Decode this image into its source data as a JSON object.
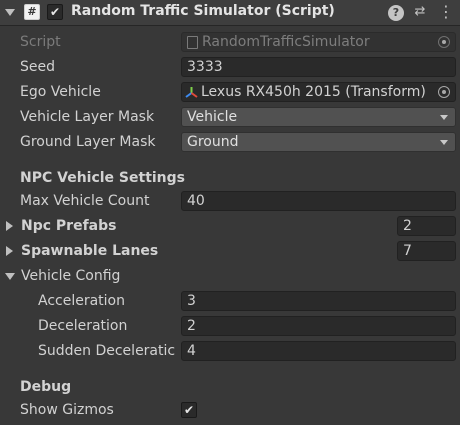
{
  "header": {
    "script_icon": "#",
    "enabled_check": "✔",
    "title": "Random Traffic Simulator (Script)",
    "help_icon": "?",
    "presets_icon": "⇄",
    "menu_icon": "⋮"
  },
  "fields": {
    "script": {
      "label": "Script",
      "value": "RandomTrafficSimulator"
    },
    "seed": {
      "label": "Seed",
      "value": "3333"
    },
    "ego_vehicle": {
      "label": "Ego Vehicle",
      "value": "Lexus RX450h 2015 (Transform)"
    },
    "vehicle_layer_mask": {
      "label": "Vehicle Layer Mask",
      "value": "Vehicle"
    },
    "ground_layer_mask": {
      "label": "Ground Layer Mask",
      "value": "Ground"
    }
  },
  "npc_settings": {
    "header": "NPC Vehicle Settings",
    "max_vehicle_count": {
      "label": "Max Vehicle Count",
      "value": "40"
    },
    "npc_prefabs": {
      "label": "Npc Prefabs",
      "count": "2"
    },
    "spawnable_lanes": {
      "label": "Spawnable Lanes",
      "count": "7"
    },
    "vehicle_config": {
      "label": "Vehicle Config",
      "acceleration": {
        "label": "Acceleration",
        "value": "3"
      },
      "deceleration": {
        "label": "Deceleration",
        "value": "2"
      },
      "sudden_deceleration": {
        "label": "Sudden Deceleratic",
        "value": "4"
      }
    }
  },
  "debug": {
    "header": "Debug",
    "show_gizmos": {
      "label": "Show Gizmos",
      "check": "✔"
    }
  },
  "colors": {
    "panel_bg": "#383838",
    "header_bg": "#3e3e3e",
    "field_bg": "#2a2a2a",
    "dropdown_bg": "#515151"
  }
}
